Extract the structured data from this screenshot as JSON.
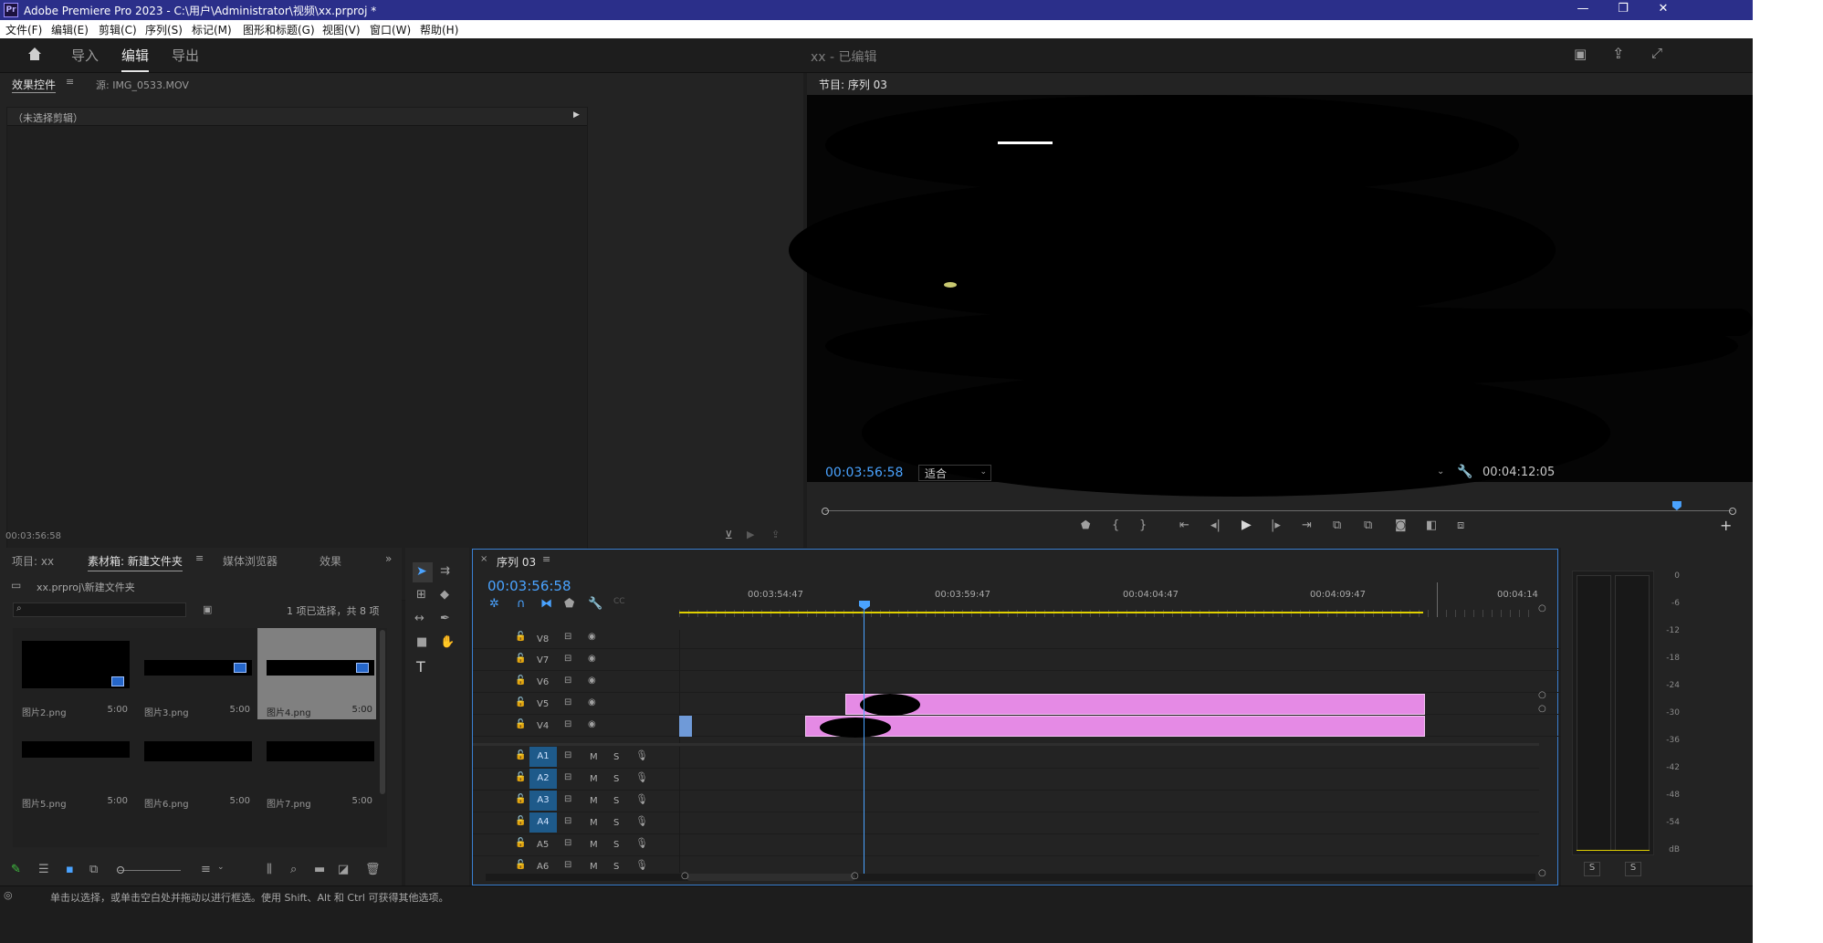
{
  "window": {
    "app_logo": "Pr",
    "title": "Adobe Premiere Pro 2023 - C:\\用户\\Administrator\\视频\\xx.prproj *",
    "minimize": "—",
    "maximize": "❐",
    "close": "✕"
  },
  "menu": [
    "文件(F)",
    "编辑(E)",
    "剪辑(C)",
    "序列(S)",
    "标记(M)",
    "图形和标题(G)",
    "视图(V)",
    "窗口(W)",
    "帮助(H)"
  ],
  "workspace": {
    "tabs": [
      "导入",
      "编辑",
      "导出"
    ],
    "active_tab": "编辑",
    "project_status": "xx - 已编辑"
  },
  "effect_controls": {
    "tab_label": "效果控件",
    "source_tab": "源: IMG_0533.MOV",
    "no_clip": "（未选择剪辑）",
    "timecode": "00:03:56:58"
  },
  "program_monitor": {
    "tab_label": "节目: 序列 03",
    "current_time": "00:03:56:58",
    "fit_label": "适合",
    "duration": "00:04:12:05",
    "playhead_fraction": 0.93
  },
  "project_panel": {
    "tabs": [
      "项目: xx",
      "素材箱: 新建文件夹",
      "媒体浏览器",
      "效果"
    ],
    "active_tab": "素材箱: 新建文件夹",
    "path": "xx.prproj\\新建文件夹",
    "selection_info": "1 项已选择，共 8 项",
    "items": [
      {
        "name": "图片2.png",
        "duration": "5:00",
        "selected": false
      },
      {
        "name": "图片3.png",
        "duration": "5:00",
        "selected": false
      },
      {
        "name": "图片4.png",
        "duration": "5:00",
        "selected": true
      },
      {
        "name": "图片5.png",
        "duration": "5:00",
        "selected": false
      },
      {
        "name": "图片6.png",
        "duration": "5:00",
        "selected": false
      },
      {
        "name": "图片7.png",
        "duration": "5:00",
        "selected": false
      }
    ]
  },
  "timeline": {
    "sequence_tab": "序列 03",
    "current_time": "00:03:56:58",
    "ruler_labels": [
      "00:03:54:47",
      "00:03:59:47",
      "00:04:04:47",
      "00:04:09:47",
      "00:04:14"
    ],
    "video_tracks": [
      "V8",
      "V7",
      "V6",
      "V5",
      "V4"
    ],
    "audio_tracks": [
      "A1",
      "A2",
      "A3",
      "A4",
      "A5",
      "A6"
    ],
    "track_m": "M",
    "track_s": "S"
  },
  "audio_meter": {
    "scale": [
      "0",
      "-6",
      "-12",
      "-18",
      "-24",
      "-30",
      "-36",
      "-42",
      "-48",
      "-54",
      "dB"
    ],
    "solo_left": "S",
    "solo_right": "S"
  },
  "status_bar": {
    "message": "单击以选择，或单击空白处并拖动以进行框选。使用 Shift、Alt 和 Ctrl 可获得其他选项。"
  },
  "colors": {
    "accent_blue": "#4aa3ff",
    "clip_pink": "#e58ae5",
    "titlebar": "#2b2f8a",
    "work_area_yellow": "#e0d000"
  }
}
